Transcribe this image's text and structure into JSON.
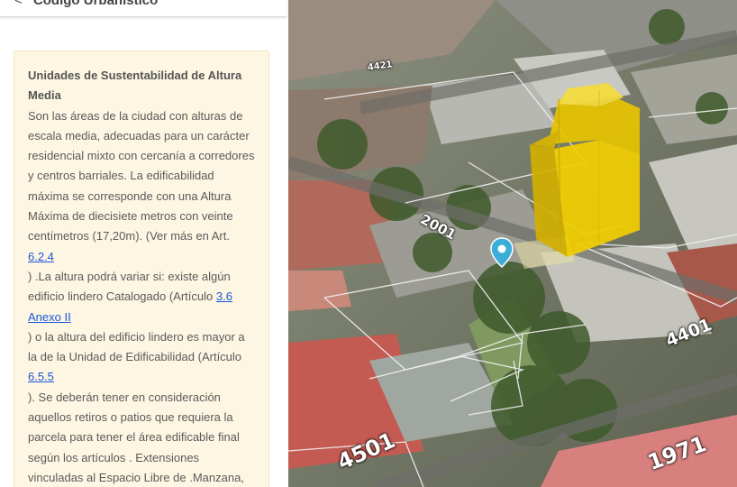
{
  "header": {
    "back_arrow": "<",
    "title": "Código Urbanístico"
  },
  "card": {
    "title": "Unidades de Sustentabilidad de Altura Media",
    "text1": "Son las áreas de la ciudad con alturas de escala media, adecuadas para un carácter residencial mixto con cercanía a corredores y centros barriales. La edificabilidad máxima se corresponde con una Altura Máxima de diecisiete metros con veinte centímetros (17,20m). (Ver más en Art.",
    "link1": "6.2.4",
    "text2": ") .La altura podrá variar si: existe algún edificio lindero Catalogado (Artículo",
    "link2": "3.6 Anexo II",
    "text3": ") o la altura del edificio lindero es mayor a la de la Unidad de Edificabilidad (Artículo",
    "link3": "6.5.5",
    "text4": "). Se deberán tener en consideración aquellos retiros o patios que requiera la parcela para tener el área edificable final según los artículos . Extensiones vinculadas al Espacio Libre de .Manzana,"
  },
  "map": {
    "labels": [
      "2001",
      "4401",
      "4501",
      "1971",
      "4421"
    ],
    "building_color": "#f2cf00",
    "marker_color": "#3aaed8",
    "marker_icon": "location-pin-icon"
  }
}
